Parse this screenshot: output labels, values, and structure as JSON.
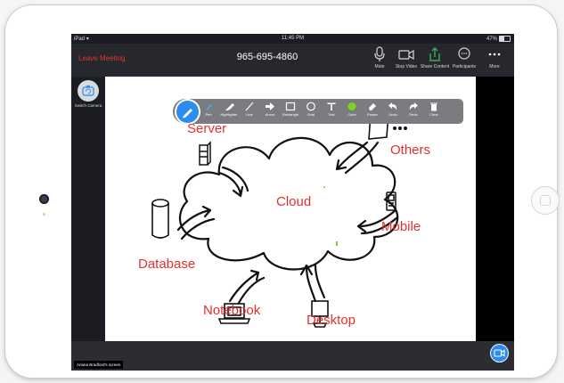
{
  "status_bar": {
    "device": "iPad",
    "time": "11:45 PM",
    "battery": "47%",
    "battery_level": 0.47
  },
  "top_bar": {
    "leave_label": "Leave Meeting",
    "meeting_id": "965-695-4860",
    "actions": [
      {
        "label": "Mute",
        "icon": "microphone-icon"
      },
      {
        "label": "Stop Video",
        "icon": "video-camera-icon"
      },
      {
        "label": "Share Content",
        "icon": "share-upload-icon"
      },
      {
        "label": "Participants",
        "icon": "participants-icon"
      },
      {
        "label": "More",
        "icon": "more-dots-icon"
      }
    ]
  },
  "left_panel": {
    "switch_camera_label": "Switch Camera"
  },
  "annotation_tools": [
    {
      "label": "Pen",
      "icon": "pen-icon"
    },
    {
      "label": "Highlighter",
      "icon": "highlighter-icon"
    },
    {
      "label": "Line",
      "icon": "line-icon"
    },
    {
      "label": "Arrow",
      "icon": "arrow-icon"
    },
    {
      "label": "Rectangle",
      "icon": "rectangle-icon"
    },
    {
      "label": "Oval",
      "icon": "oval-icon"
    },
    {
      "label": "Text",
      "icon": "text-icon"
    },
    {
      "label": "Color",
      "icon": "color-icon"
    },
    {
      "label": "Eraser",
      "icon": "eraser-icon"
    },
    {
      "label": "Undo",
      "icon": "undo-icon"
    },
    {
      "label": "Redo",
      "icon": "redo-icon"
    },
    {
      "label": "Clear",
      "icon": "trash-icon"
    }
  ],
  "diagram_labels": {
    "server": "Server",
    "others": "Others",
    "cloud": "Cloud",
    "mobile": "Mobile",
    "database": "Database",
    "notebook": "Notebook",
    "desktop": "Desktop"
  },
  "bottom_bar": {
    "screen_owner": "Ariana Bradford's screen"
  },
  "colors": {
    "accent": "#2d8cf0",
    "leave": "#e3342f",
    "annotation": "#e52f2f",
    "color_tool": "#7ed321"
  }
}
